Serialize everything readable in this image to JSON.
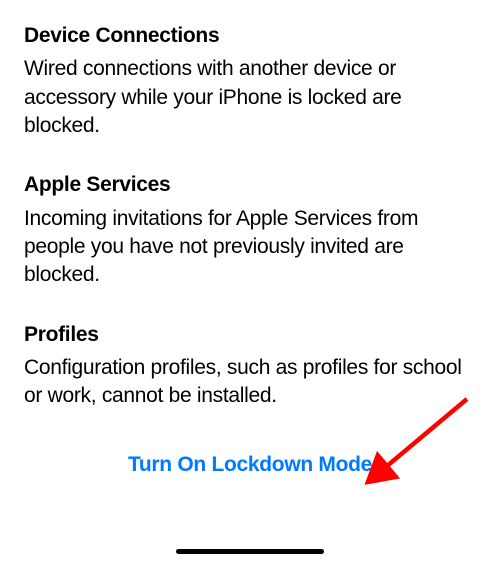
{
  "sections": [
    {
      "title": "Device Connections",
      "body": "Wired connections with another device or accessory while your iPhone is locked are blocked."
    },
    {
      "title": "Apple Services",
      "body": "Incoming invitations for Apple Services from people you have not previously invited are blocked."
    },
    {
      "title": "Profiles",
      "body": "Configuration profiles, such as profiles for school or work, cannot be installed."
    }
  ],
  "action": {
    "label": "Turn On Lockdown Mode"
  },
  "colors": {
    "link": "#007aff",
    "annotation": "#ff0000"
  }
}
